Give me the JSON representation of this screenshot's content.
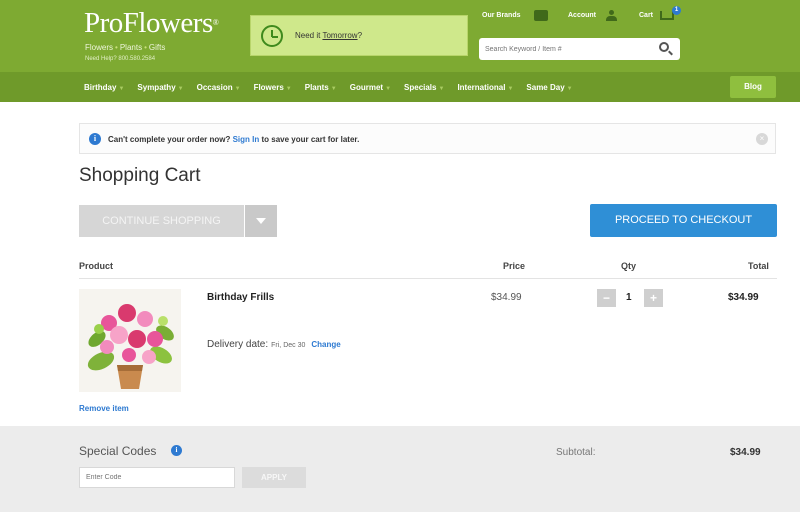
{
  "header": {
    "logo": "ProFlowers",
    "logo_tm": "®",
    "logo_sub": [
      "Flowers",
      "Plants",
      "Gifts"
    ],
    "help": "Need Help? 800.580.2584",
    "promo": {
      "text": "Need it ",
      "link": "Tomorrow",
      "suffix": "?"
    },
    "top_links": {
      "brands": "Our Brands",
      "account": "Account",
      "cart": "Cart",
      "cart_count": "1"
    },
    "search": {
      "placeholder": "Search Keyword / Item #"
    }
  },
  "nav": {
    "items": [
      "Birthday",
      "Sympathy",
      "Occasion",
      "Flowers",
      "Plants",
      "Gourmet",
      "Specials",
      "International",
      "Same Day"
    ],
    "blog": "Blog"
  },
  "alert": {
    "text_before": "Can't complete your order now? ",
    "link": "Sign In",
    "text_after": " to save your cart for later.",
    "close": "×"
  },
  "cart": {
    "title": "Shopping Cart",
    "continue_label": "CONTINUE SHOPPING",
    "checkout_label": "PROCEED TO CHECKOUT",
    "columns": {
      "product": "Product",
      "price": "Price",
      "qty": "Qty",
      "total": "Total"
    },
    "item": {
      "name": "Birthday Frills",
      "delivery_label": "Delivery date:",
      "delivery_date": "Fri, Dec 30",
      "change": "Change",
      "price": "$34.99",
      "qty": "1",
      "total": "$34.99",
      "remove": "Remove item"
    }
  },
  "footer": {
    "codes_title": "Special Codes",
    "code_placeholder": "Enter Code",
    "apply_label": "APPLY",
    "subtotal_label": "Subtotal:",
    "subtotal_value": "$34.99"
  },
  "colors": {
    "header_green": "#7eaa32",
    "nav_green": "#6f9a2a",
    "accent_blue": "#2f8fd6",
    "link_blue": "#2e7ad1"
  }
}
